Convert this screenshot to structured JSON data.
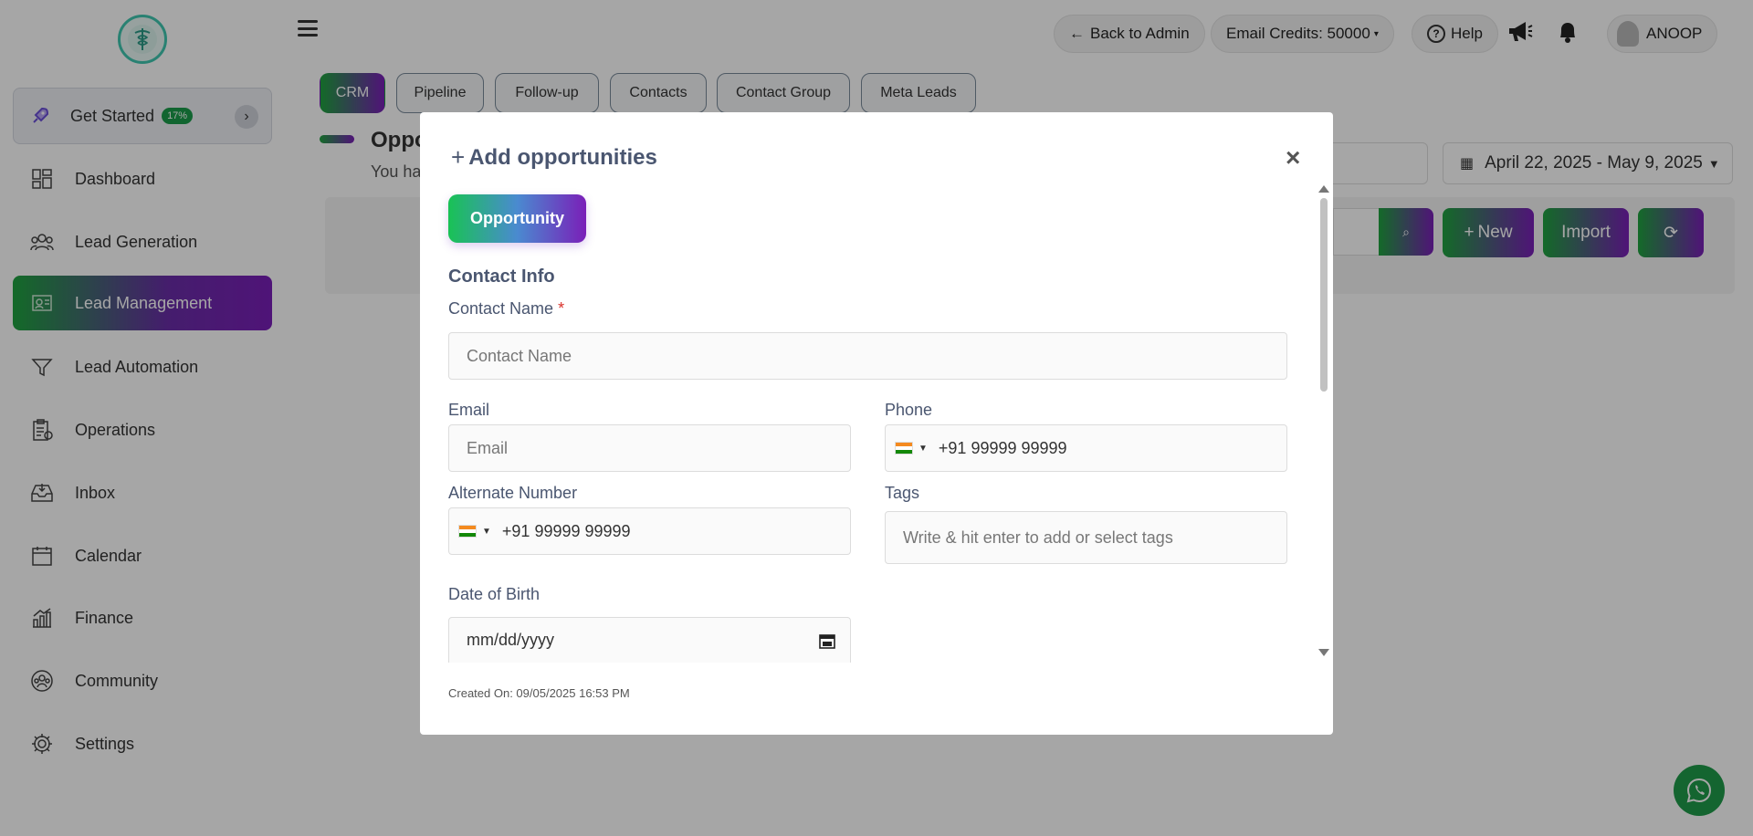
{
  "sidebar": {
    "get_started": {
      "label": "Get Started",
      "badge": "17%"
    },
    "items": [
      {
        "label": "Dashboard",
        "icon": "dashboard-icon"
      },
      {
        "label": "Lead Generation",
        "icon": "users-icon"
      },
      {
        "label": "Lead Management",
        "icon": "lead-management-icon",
        "active": true
      },
      {
        "label": "Lead Automation",
        "icon": "funnel-icon"
      },
      {
        "label": "Operations",
        "icon": "clipboard-icon"
      },
      {
        "label": "Inbox",
        "icon": "inbox-icon"
      },
      {
        "label": "Calendar",
        "icon": "calendar-icon"
      },
      {
        "label": "Finance",
        "icon": "finance-icon"
      },
      {
        "label": "Community",
        "icon": "community-icon"
      },
      {
        "label": "Settings",
        "icon": "gear-icon"
      }
    ]
  },
  "topbar": {
    "back_label": "Back to Admin",
    "credits_label": "Email Credits: 50000",
    "help_label": "Help",
    "user_name": "ANOOP"
  },
  "tabs": [
    "CRM",
    "Pipeline",
    "Follow-up",
    "Contacts",
    "Contact Group",
    "Meta Leads"
  ],
  "page": {
    "title": "Oppo",
    "subtitle": "You ha",
    "date_range": "April 22, 2025 - May 9, 2025",
    "new_label": "New",
    "import_label": "Import"
  },
  "modal": {
    "title": "Add opportunities",
    "close": "×",
    "opportunity_button": "Opportunity",
    "section": "Contact Info",
    "fields": {
      "contact_name_label": "Contact Name",
      "required_mark": "*",
      "contact_name_placeholder": "Contact Name",
      "email_label": "Email",
      "email_placeholder": "Email",
      "phone_label": "Phone",
      "phone_value": "+91 99999 99999",
      "alt_label": "Alternate Number",
      "alt_value": "+91 99999 99999",
      "tags_label": "Tags",
      "tags_placeholder": "Write & hit enter to add or select tags",
      "dob_label": "Date of Birth",
      "dob_placeholder": "mm/dd/yyyy"
    },
    "created_on": "Created On: 09/05/2025 16:53 PM"
  },
  "colors": {
    "accent_green": "#1fa33f",
    "accent_purple": "#7a1fb8",
    "label_color": "#4a5670",
    "whatsapp": "#1f9c4a"
  }
}
